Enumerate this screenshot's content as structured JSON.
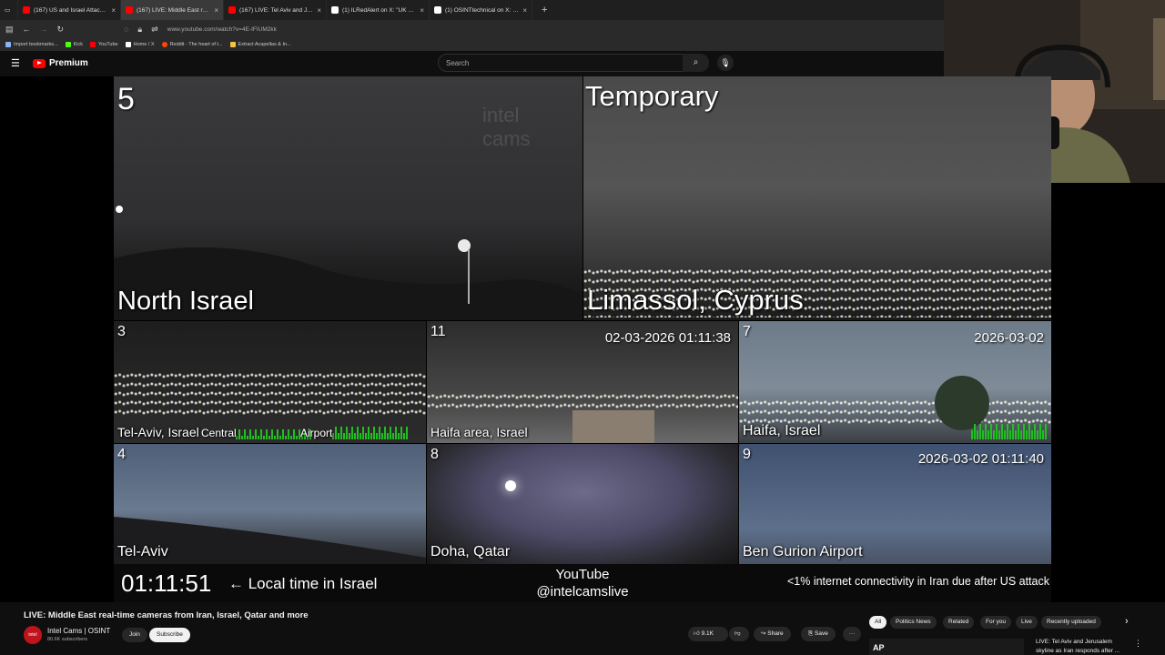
{
  "browser": {
    "tabs": [
      {
        "title": "(167) US and Israel Attack Iran",
        "fav_color": "#ff0000",
        "active": false
      },
      {
        "title": "(167) LIVE: Middle East real-",
        "fav_color": "#ff0000",
        "active": true
      },
      {
        "title": "(167) LIVE: Tel Aviv and Jerusale",
        "fav_color": "#ff0000",
        "active": false
      },
      {
        "title": "(1) ILRedAlert on X: \"UK Prime M",
        "fav_color": "#ffffff",
        "active": false
      },
      {
        "title": "(1) OSINTtechnical on X: \"Foota",
        "fav_color": "#ffffff",
        "active": false
      }
    ],
    "new_tab": "+",
    "url": "www.youtube.com/watch?v=4E-IFIUM2kk",
    "bookmarks": [
      {
        "label": "Import bookmarks...",
        "color": "#8ab4f8"
      },
      {
        "label": "Kick",
        "color": "#53fc18"
      },
      {
        "label": "YouTube",
        "color": "#ff0000"
      },
      {
        "label": "Home / X",
        "color": "#ffffff"
      },
      {
        "label": "Reddit - The heart of t...",
        "color": "#ff4500"
      },
      {
        "label": "Extract Acapellas & In...",
        "color": "#f6c343"
      }
    ]
  },
  "youtube": {
    "logo_text": "Premium",
    "search_placeholder": "Search"
  },
  "cams": {
    "cam5": {
      "num": "5",
      "label": "North Israel",
      "watermark": "intel cams"
    },
    "temp": {
      "label": "Limassol, Cyprus",
      "title": "Temporary"
    },
    "cam3": {
      "num": "3",
      "label": "Tel-Aviv, Israel",
      "extra1": "Central",
      "extra2": "Airport"
    },
    "cam11": {
      "num": "11",
      "label": "Haifa area, Israel",
      "timestamp": "02-03-2026 01:11:38"
    },
    "cam7": {
      "num": "7",
      "label": "Haifa, Israel",
      "timestamp": "2026-03-02"
    },
    "cam4": {
      "num": "4",
      "label": "Tel-Aviv"
    },
    "cam8": {
      "num": "8",
      "label": "Doha, Qatar"
    },
    "cam9": {
      "num": "9",
      "label": "Ben Gurion Airport",
      "timestamp": "2026-03-02 01:11:40"
    }
  },
  "overlay": {
    "clock": "01:11:51",
    "local_time_label": "← Local time in Israel",
    "yt_line1": "YouTube",
    "yt_line2": "@intelcamslive",
    "ticker": "<1% internet connectivity in Iran due after US attack"
  },
  "video_info": {
    "title": "LIVE: Middle East real-time cameras from Iran, Israel, Qatar and more",
    "channel": "Intel Cams | OSINT",
    "subscribers": "80.6K subscribers",
    "join": "Join",
    "subscribe": "Subscribe",
    "likes": "9.1K",
    "share": "Share",
    "save": "Save",
    "more": "···"
  },
  "chips": [
    "All",
    "Politics News",
    "Related",
    "For you",
    "Live",
    "Recently uploaded"
  ],
  "recommendation": {
    "title_line1": "LIVE: Tel Aviv and Jerusalem",
    "title_line2": "skyline as Iran responds after ...",
    "badge": "AP"
  }
}
